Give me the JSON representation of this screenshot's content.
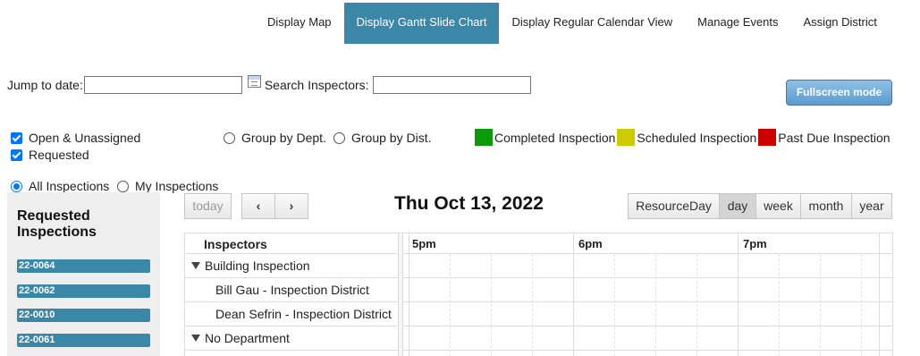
{
  "nav": {
    "items": [
      {
        "label": "Display Map"
      },
      {
        "label": "Display Gantt Slide Chart"
      },
      {
        "label": "Display Regular Calendar View"
      },
      {
        "label": "Manage Events"
      },
      {
        "label": "Assign District"
      }
    ],
    "active_index": 1
  },
  "toolbar_top": {
    "jump_label": "Jump to date:",
    "jump_value": "",
    "search_label": "Search Inspectors:",
    "search_value": "",
    "fullscreen_label": "Fullscreen mode"
  },
  "filters": {
    "open_unassigned": {
      "label": "Open & Unassigned",
      "checked": true
    },
    "requested": {
      "label": "Requested",
      "checked": true
    },
    "group_dept": {
      "label": "Group by Dept.",
      "selected": false
    },
    "group_dist": {
      "label": "Group by Dist.",
      "selected": false
    },
    "all_inspections": {
      "label": "All Inspections",
      "selected": true
    },
    "my_inspections": {
      "label": "My Inspections",
      "selected": false
    }
  },
  "legend": [
    {
      "label": "Completed Inspection",
      "color": "#0a9a0a"
    },
    {
      "label": "Scheduled Inspection",
      "color": "#cccc00"
    },
    {
      "label": "Past Due Inspection",
      "color": "#cc0000"
    }
  ],
  "requested_panel": {
    "title": "Requested Inspections",
    "items": [
      "22-0064",
      "22-0062",
      "22-0010",
      "22-0061"
    ]
  },
  "calendar": {
    "today_label": "today",
    "prev_icon": "chevron-left-icon",
    "next_icon": "chevron-right-icon",
    "date_title": "Thu Oct 13, 2022",
    "views": [
      "ResourceDay",
      "day",
      "week",
      "month",
      "year"
    ],
    "active_view": "day",
    "resource_header": "Inspectors",
    "time_headers": [
      "5pm",
      "6pm",
      "7pm"
    ],
    "rows": [
      {
        "label": "Building Inspection",
        "group": true
      },
      {
        "label": "Bill Gau - Inspection District",
        "group": false
      },
      {
        "label": "Dean Sefrin - Inspection District",
        "group": false
      },
      {
        "label": "No Department",
        "group": true
      }
    ]
  }
}
